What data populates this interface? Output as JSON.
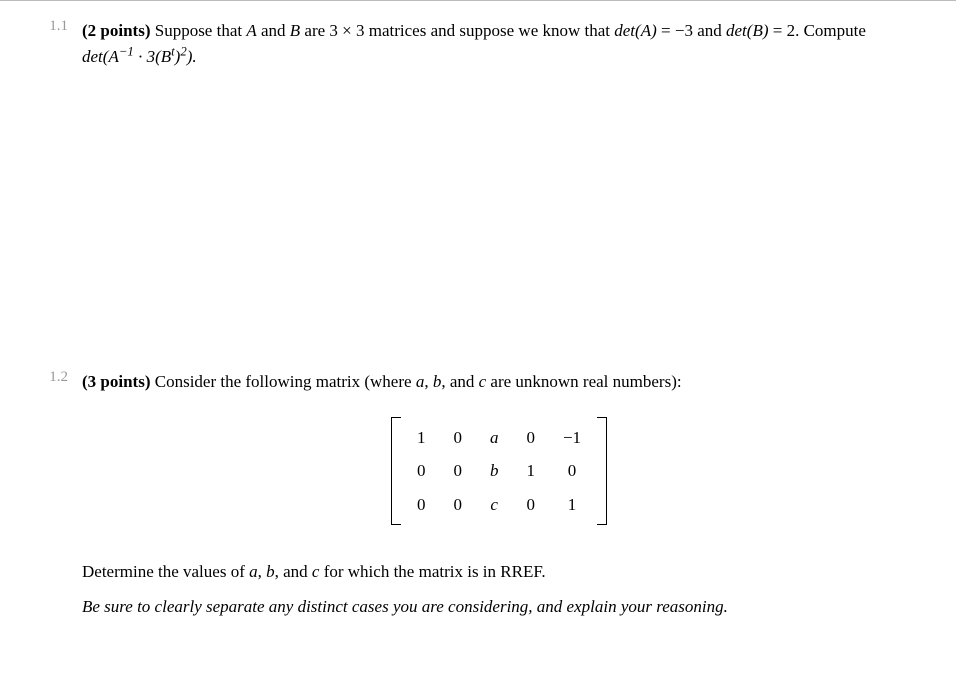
{
  "problems": [
    {
      "num": "1.1",
      "points": "(2 points)",
      "text_parts": {
        "t1": " Suppose that ",
        "A": "A",
        "t2": " and ",
        "B": "B",
        "t3": " are 3 × 3 matrices and suppose we know that ",
        "detA_lhs": "det",
        "detA_arg": "(A)",
        "t4": " = −3 and ",
        "detB_lhs": "det",
        "detB_arg": "(B)",
        "t5": " = 2. Compute ",
        "expr_det": "det",
        "expr_open": "(A",
        "expr_sup1": "−1",
        "expr_mid": " · 3(B",
        "expr_sup2": "t",
        "expr_close1": ")",
        "expr_sup3": "2",
        "expr_close2": ")."
      }
    },
    {
      "num": "1.2",
      "points": "(3 points)",
      "text_parts": {
        "t1": " Consider the following matrix (where ",
        "a": "a",
        "c1": ", ",
        "b": "b",
        "c2": ", and ",
        "c": "c",
        "t2": " are unknown real numbers):"
      },
      "matrix": [
        [
          "1",
          "0",
          "a",
          "0",
          "−1"
        ],
        [
          "0",
          "0",
          "b",
          "1",
          "0"
        ],
        [
          "0",
          "0",
          "c",
          "0",
          "1"
        ]
      ],
      "para2": {
        "t1": "Determine the values of ",
        "a": "a",
        "c1": ", ",
        "b": "b",
        "c2": ", and ",
        "c": "c",
        "t2": " for which the matrix is in RREF."
      },
      "instruction": "Be sure to clearly separate any distinct cases you are considering, and explain your reasoning."
    }
  ],
  "chart_data": {
    "type": "table",
    "title": "3x5 matrix with unknowns a, b, c",
    "rows": [
      [
        "1",
        "0",
        "a",
        "0",
        "-1"
      ],
      [
        "0",
        "0",
        "b",
        "1",
        "0"
      ],
      [
        "0",
        "0",
        "c",
        "0",
        "1"
      ]
    ]
  }
}
